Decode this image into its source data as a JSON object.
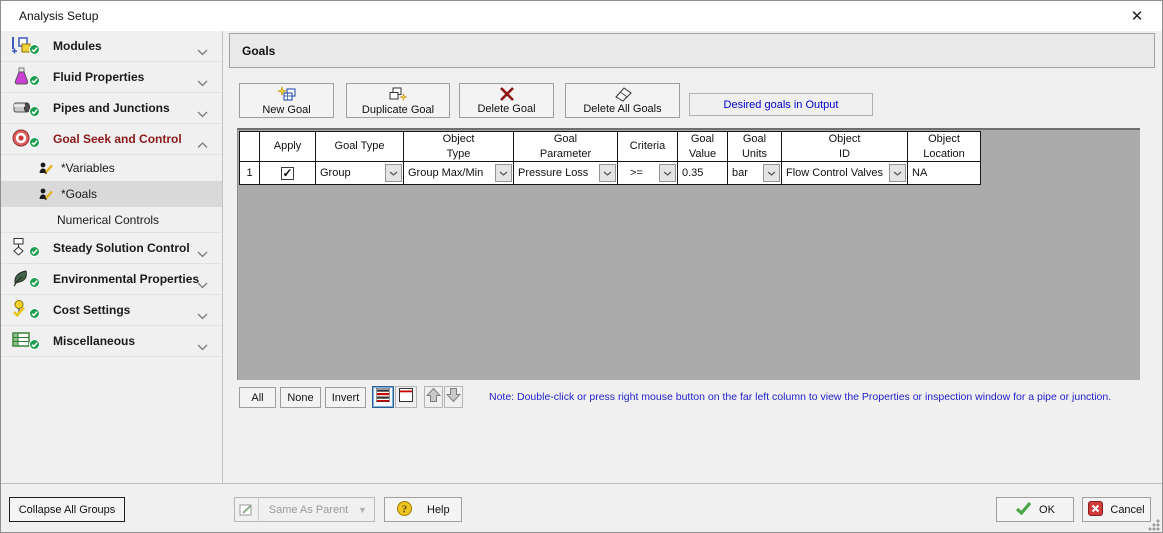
{
  "window": {
    "title": "Analysis Setup",
    "close_glyph": "✕"
  },
  "sidebar": {
    "groups": [
      {
        "label": "Modules"
      },
      {
        "label": "Fluid Properties"
      },
      {
        "label": "Pipes and Junctions"
      },
      {
        "label": "Goal Seek and Control"
      },
      {
        "label": "Steady Solution Control"
      },
      {
        "label": "Environmental Properties"
      },
      {
        "label": "Cost Settings"
      },
      {
        "label": "Miscellaneous"
      }
    ],
    "goal_seek_children": [
      {
        "label": "*Variables"
      },
      {
        "label": "*Goals"
      },
      {
        "label": "Numerical Controls"
      }
    ],
    "accent_color": "#8b1a1a"
  },
  "main": {
    "panel_title": "Goals",
    "toolbar": {
      "new_goal": "New Goal",
      "duplicate_goal": "Duplicate Goal",
      "delete_goal": "Delete Goal",
      "delete_all_goals": "Delete All Goals",
      "desired_goals_label": "Desired goals in Output"
    },
    "table": {
      "headers": [
        "",
        "Apply",
        "Goal Type",
        "Object\nType",
        "Goal\nParameter",
        "Criteria",
        "Goal\nValue",
        "Goal\nUnits",
        "Object\nID",
        "Object\nLocation"
      ],
      "rows": [
        {
          "num": "1",
          "apply_checked": true,
          "check_glyph": "✓",
          "goal_type": "Group",
          "object_type": "Group Max/Min",
          "goal_parameter": "Pressure Loss",
          "criteria": ">=",
          "goal_value": "0.35",
          "goal_units": "bar",
          "object_id": "Flow Control Valves",
          "object_location": "NA"
        }
      ]
    },
    "selection_buttons": {
      "all": "All",
      "none": "None",
      "invert": "Invert"
    },
    "note": "Note: Double-click or press right mouse button on the far left column to view the Properties or inspection window for a pipe or junction.",
    "note_color": "#2222cc"
  },
  "footer": {
    "collapse_all": "Collapse All Groups",
    "same_as_parent": "Same As Parent",
    "help": "Help",
    "ok": "OK",
    "cancel": "Cancel"
  }
}
